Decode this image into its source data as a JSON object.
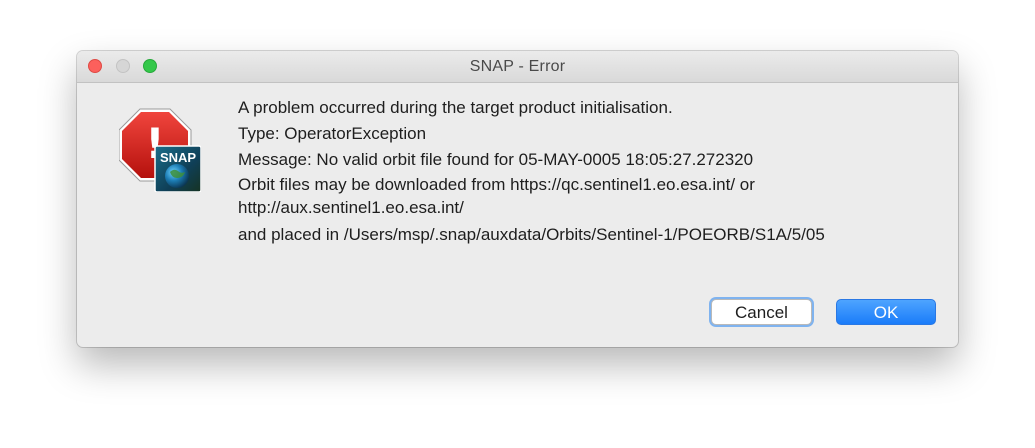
{
  "window": {
    "title": "SNAP - Error"
  },
  "icon": {
    "badge_text": "SNAP",
    "stop_sign_symbol": "!",
    "icon_name": "error-stop-icon"
  },
  "message": {
    "lines": [
      "A problem occurred during the target product initialisation.",
      "Type: OperatorException",
      "Message: No valid orbit file found for 05-MAY-0005 18:05:27.272320",
      "Orbit files may be downloaded from https://qc.sentinel1.eo.esa.int/ or http://aux.sentinel1.eo.esa.int/",
      "and placed in /Users/msp/.snap/auxdata/Orbits/Sentinel-1/POEORB/S1A/5/05"
    ]
  },
  "buttons": {
    "cancel_label": "Cancel",
    "ok_label": "OK"
  },
  "colors": {
    "ok_button": "#1a7cf9",
    "close_light": "#fc605c",
    "zoom_light": "#34c84a",
    "stop_sign": "#d0201b"
  }
}
